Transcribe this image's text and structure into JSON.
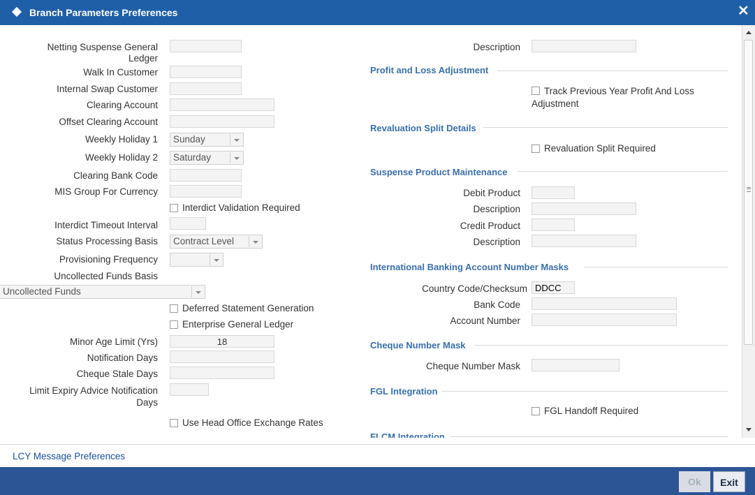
{
  "window": {
    "title": "Branch Parameters Preferences",
    "close_label": "✕"
  },
  "left": {
    "netting_suspense_gl_line1": "Netting Suspense General",
    "netting_suspense_gl_line2": "Ledger",
    "walk_in_customer": "Walk In Customer",
    "internal_swap_customer": "Internal Swap Customer",
    "clearing_account": "Clearing Account",
    "offset_clearing_account": "Offset Clearing Account",
    "weekly_holiday_1": "Weekly Holiday 1",
    "weekly_holiday_1_value": "Sunday",
    "weekly_holiday_2": "Weekly Holiday 2",
    "weekly_holiday_2_value": "Saturday",
    "clearing_bank_code": "Clearing Bank Code",
    "mis_group_for_currency": "MIS Group For Currency",
    "interdict_validation_required": "Interdict Validation Required",
    "interdict_timeout_interval": "Interdict Timeout Interval",
    "status_processing_basis": "Status Processing Basis",
    "status_processing_basis_value": "Contract Level",
    "provisioning_frequency": "Provisioning Frequency",
    "provisioning_frequency_value": "",
    "uncollected_funds_basis": "Uncollected Funds Basis",
    "uncollected_funds_basis_value": "Uncollected Funds",
    "deferred_statement_generation": "Deferred Statement Generation",
    "enterprise_general_ledger": "Enterprise General Ledger",
    "minor_age_limit": "Minor Age Limit (Yrs)",
    "minor_age_limit_value": "18",
    "notification_days": "Notification Days",
    "cheque_stale_days": "Cheque Stale Days",
    "limit_expiry_line1": "Limit Expiry Advice Notification",
    "limit_expiry_line2": "Days",
    "use_head_office_exchange_rates": "Use Head Office Exchange Rates"
  },
  "right": {
    "description": "Description",
    "profit_loss_section": "Profit and Loss Adjustment",
    "track_prev_year_line1": "Track Previous Year Profit And Loss",
    "track_prev_year_line2": "Adjustment",
    "revaluation_section": "Revaluation Split Details",
    "revaluation_split_required": "Revaluation Split Required",
    "suspense_section": "Suspense Product Maintenance",
    "debit_product": "Debit Product",
    "debit_description": "Description",
    "credit_product": "Credit Product",
    "credit_description": "Description",
    "iban_section": "International Banking Account Number Masks",
    "country_code_checksum": "Country Code/Checksum",
    "country_code_checksum_value": "DDCC",
    "bank_code": "Bank Code",
    "account_number": "Account Number",
    "cheque_section": "Cheque Number Mask",
    "cheque_number_mask": "Cheque Number Mask",
    "fgl_section": "FGL Integration",
    "fgl_handoff_required": "FGL Handoff Required",
    "flcm_section": "FLCM Integration"
  },
  "lcy_link": "LCY Message Preferences",
  "footer": {
    "ok_label": "Ok",
    "exit_label": "Exit"
  }
}
